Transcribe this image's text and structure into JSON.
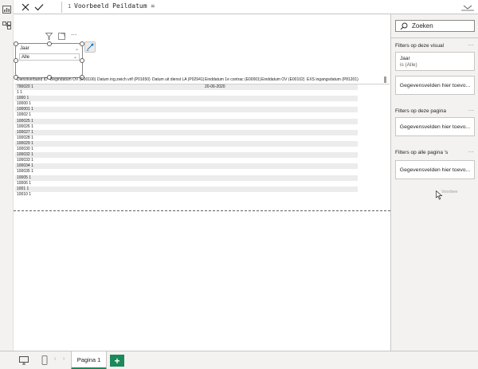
{
  "formula_bar": {
    "line_number": "1",
    "formula": "Voorbeeld Peildatum ="
  },
  "slicer": {
    "title": "Jaar",
    "selected": "Alle"
  },
  "table": {
    "headers": [
      "Dienstverband ID",
      "Begindatum OV (E00100)",
      "Datum ing.zwich.vrlf (P01650)",
      "Datum uit dienst LA (P02941)",
      "Einddatum 1e contrac (E00001)",
      "Einddatum OV (E00102)",
      "EXS ingangsdatum (P81201)"
    ],
    "rows": [
      {
        "id": "790020 1",
        "einddatum": "20-06-2020"
      },
      {
        "id": "1 1",
        "einddatum": ""
      },
      {
        "id": "1000 1",
        "einddatum": ""
      },
      {
        "id": "10000 1",
        "einddatum": ""
      },
      {
        "id": "100001 1",
        "einddatum": ""
      },
      {
        "id": "10002 1",
        "einddatum": ""
      },
      {
        "id": "100025 1",
        "einddatum": ""
      },
      {
        "id": "100026 1",
        "einddatum": ""
      },
      {
        "id": "100027 1",
        "einddatum": ""
      },
      {
        "id": "100028 1",
        "einddatum": ""
      },
      {
        "id": "100029 1",
        "einddatum": ""
      },
      {
        "id": "100030 1",
        "einddatum": ""
      },
      {
        "id": "100032 1",
        "einddatum": ""
      },
      {
        "id": "100033 1",
        "einddatum": ""
      },
      {
        "id": "100034 1",
        "einddatum": ""
      },
      {
        "id": "100035 1",
        "einddatum": ""
      },
      {
        "id": "10005 1",
        "einddatum": ""
      },
      {
        "id": "10006 1",
        "einddatum": ""
      },
      {
        "id": "1001 1",
        "einddatum": ""
      },
      {
        "id": "10010 1",
        "einddatum": ""
      }
    ]
  },
  "filter_pane": {
    "search_placeholder": "Zoeken",
    "section_visual": "Filters op deze visual",
    "section_page": "Filters op deze pagina",
    "section_all": "Filters op alle pagina 's",
    "more_dots": "...",
    "visual_filter_field": "Jaar",
    "visual_filter_value": "is (Alle)",
    "add_fields_label": "Gegevensvelden hier toevo...",
    "drag_ghost": "Voorbee"
  },
  "bottom_bar": {
    "page_tab": "Pagina 1",
    "add_page": "+"
  },
  "colors": {
    "accent_green": "#1a8a5a",
    "pane_bg": "#f3f2f1"
  }
}
